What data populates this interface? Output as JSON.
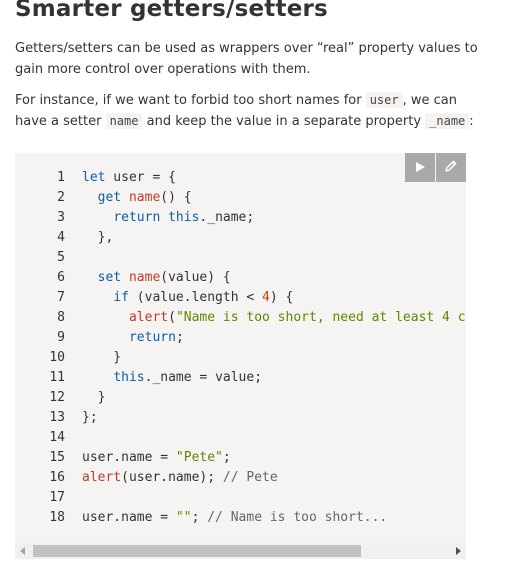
{
  "heading": "Smarter getters/setters",
  "para1": {
    "line1": "Getters/setters can be used as wrappers over “real” property values to",
    "line2": "gain more control over operations with them."
  },
  "para2": {
    "line1_a": "For instance, if we want to forbid too short names for ",
    "code1": "user",
    "line1_b": ", we can",
    "line2_a": "have a setter ",
    "code2": "name",
    "line2_b": " and keep the value in a separate property ",
    "code3": "_name",
    "line2_c": ":"
  },
  "toolbar": {
    "run_icon": "play-icon",
    "edit_icon": "pencil-icon"
  },
  "code": {
    "line_numbers": [
      "1",
      "2",
      "3",
      "4",
      "5",
      "6",
      "7",
      "8",
      "9",
      "10",
      "11",
      "12",
      "13",
      "14",
      "15",
      "16",
      "17",
      "18"
    ],
    "lines": [
      "let user = {",
      "  get name() {",
      "    return this._name;",
      "  },",
      "",
      "  set name(value) {",
      "    if (value.length < 4) {",
      "      alert(\"Name is too short, need at least 4 c",
      "      return;",
      "    }",
      "    this._name = value;",
      "  }",
      "};",
      "",
      "user.name = \"Pete\";",
      "alert(user.name); // Pete",
      "",
      "user.name = \"\"; // Name is too short..."
    ]
  },
  "colors": {
    "keyword": "#0a5fa8",
    "function": "#c0392b",
    "string": "#5a8a00",
    "number": "#d04000",
    "code_bg": "#f6f4f2",
    "toolbar_bg": "#a9a9a9"
  }
}
